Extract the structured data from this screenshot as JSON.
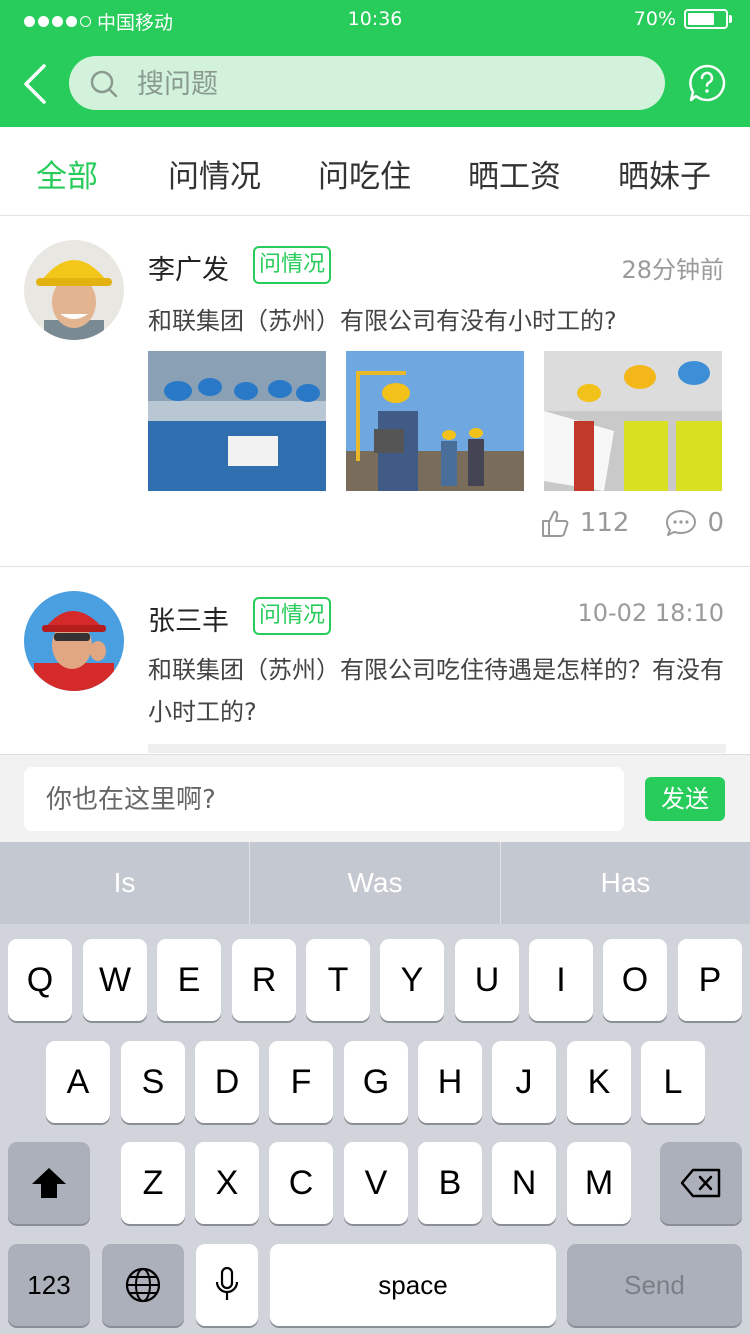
{
  "status": {
    "carrier": "中国移动",
    "time": "10:36",
    "battery": "70%",
    "signal_bars": 4,
    "signal_total": 5,
    "battery_level": 0.7
  },
  "header": {
    "search_placeholder": "搜问题"
  },
  "tabs": [
    {
      "label": "全部",
      "active": true
    },
    {
      "label": "问情况",
      "active": false
    },
    {
      "label": "问吃住",
      "active": false
    },
    {
      "label": "晒工资",
      "active": false
    },
    {
      "label": "晒妹子",
      "active": false
    }
  ],
  "posts": [
    {
      "author": "李广发",
      "tag": "问情况",
      "time": "28分钟前",
      "text": "和联集团（苏州）有限公司有没有小时工的?",
      "likes": "112",
      "comments": "0"
    },
    {
      "author": "张三丰",
      "tag": "问情况",
      "time": "10-02 18:10",
      "text_line1": "和联集团（苏州）有限公司吃住待遇是怎样的？有没有",
      "text_line2": "小时工的?"
    }
  ],
  "comment_bar": {
    "placeholder": "你也在这里啊?",
    "send_label": "发送"
  },
  "keyboard": {
    "suggestions": [
      "Is",
      "Was",
      "Has"
    ],
    "row1": [
      "Q",
      "W",
      "E",
      "R",
      "T",
      "Y",
      "U",
      "I",
      "O",
      "P"
    ],
    "row2": [
      "A",
      "S",
      "D",
      "F",
      "G",
      "H",
      "J",
      "K",
      "L"
    ],
    "row3": [
      "Z",
      "X",
      "C",
      "V",
      "B",
      "N",
      "M"
    ],
    "numbers_label": "123",
    "space_label": "space",
    "send_label": "Send"
  },
  "colors": {
    "brand": "#27cc5b",
    "search_bg": "#d3f2dc",
    "keyboard_bg": "#d1d5db"
  }
}
